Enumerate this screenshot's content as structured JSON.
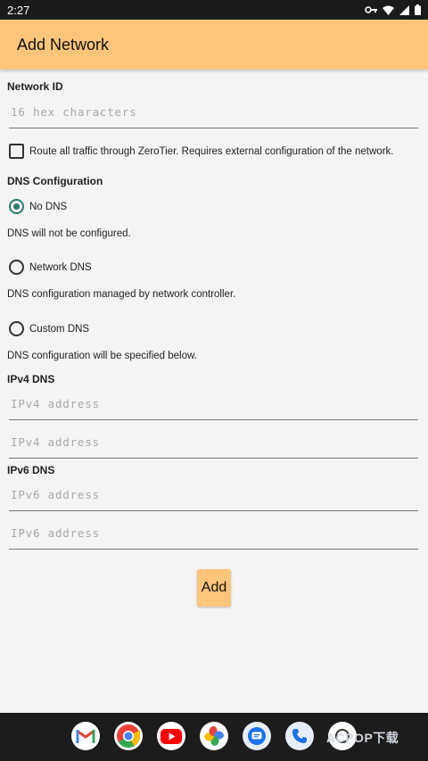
{
  "status_bar": {
    "time": "2:27"
  },
  "app_bar": {
    "title": "Add Network"
  },
  "form": {
    "network_id_label": "Network ID",
    "network_id_placeholder": "16 hex characters",
    "network_id_value": "",
    "route_all_label": "Route all traffic through ZeroTier. Requires external configuration of the network.",
    "route_all_checked": false,
    "dns_config_label": "DNS Configuration",
    "dns_options": [
      {
        "label": "No DNS",
        "description": "DNS will not be configured.",
        "checked": true
      },
      {
        "label": "Network DNS",
        "description": "DNS configuration managed by network controller.",
        "checked": false
      },
      {
        "label": "Custom DNS",
        "description": "DNS configuration will be specified below.",
        "checked": false
      }
    ],
    "ipv4_label": "IPv4 DNS",
    "ipv4_placeholder": "IPv4 address",
    "ipv6_label": "IPv6 DNS",
    "ipv6_placeholder": "IPv6 address",
    "add_label": "Add"
  },
  "dock": {
    "apps": [
      "gmail-icon",
      "chrome-icon",
      "youtube-icon",
      "photos-icon",
      "messages-icon",
      "phone-icon",
      "app-icon"
    ]
  },
  "watermark": {
    "text": "ACPOP下载"
  },
  "colors": {
    "accent": "#fcc57a",
    "radio_checked": "#2a7d70",
    "nav_bg": "#1c1c1c"
  }
}
